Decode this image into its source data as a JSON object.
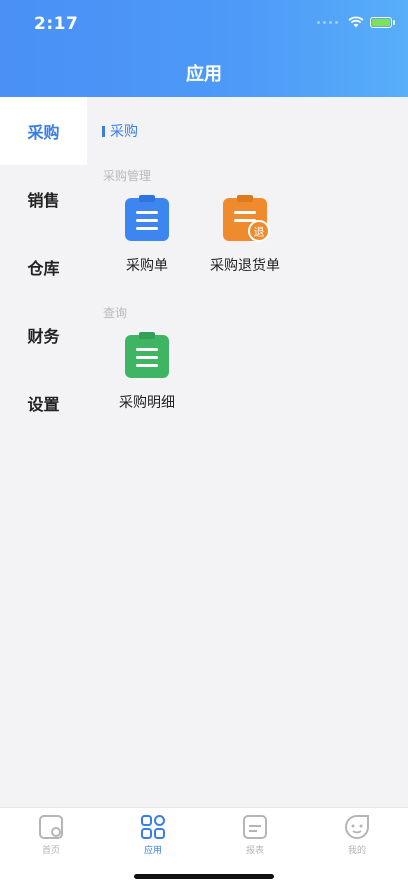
{
  "status": {
    "time": "2:17"
  },
  "header": {
    "title": "应用"
  },
  "sidebar": {
    "items": [
      {
        "label": "采购",
        "active": true
      },
      {
        "label": "销售",
        "active": false
      },
      {
        "label": "仓库",
        "active": false
      },
      {
        "label": "财务",
        "active": false
      },
      {
        "label": "设置",
        "active": false
      }
    ]
  },
  "content": {
    "section_title": "采购",
    "groups": [
      {
        "label": "采购管理",
        "apps": [
          {
            "label": "采购单",
            "icon": "clipboard-icon",
            "color": "#3d86f0"
          },
          {
            "label": "采购退货单",
            "icon": "return-clipboard-icon",
            "color": "#ef8b2c",
            "badge": "退"
          }
        ]
      },
      {
        "label": "查询",
        "apps": [
          {
            "label": "采购明细",
            "icon": "clipboard-icon",
            "color": "#3fb564"
          }
        ]
      }
    ]
  },
  "tabbar": {
    "items": [
      {
        "label": "首页",
        "icon": "home-icon",
        "active": false
      },
      {
        "label": "应用",
        "icon": "apps-grid-icon",
        "active": true
      },
      {
        "label": "报表",
        "icon": "report-icon",
        "active": false
      },
      {
        "label": "我的",
        "icon": "profile-icon",
        "active": false
      }
    ]
  },
  "colors": {
    "accent": "#3a7de9",
    "header_gradient_start": "#4a90f5",
    "header_gradient_end": "#58aef9"
  }
}
